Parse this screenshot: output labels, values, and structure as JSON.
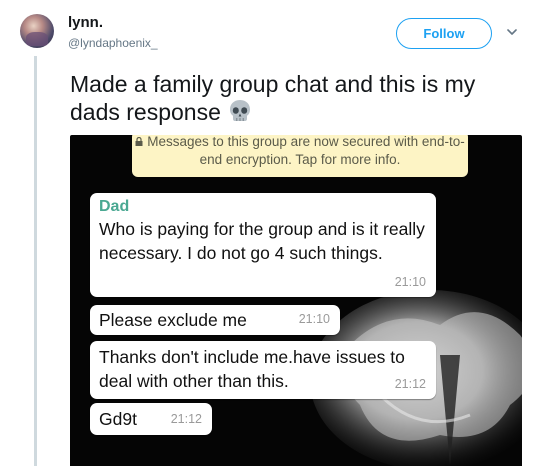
{
  "tweet": {
    "author_name": "lynn.",
    "handle": "@lyndaphoenix_",
    "follow_label": "Follow",
    "text": "Made a family group chat and this is my dads response",
    "emoji": "skull-icon"
  },
  "chat_screenshot": {
    "encryption_notice": "Messages to this group are now secured with end-to-end encryption. Tap for more info.",
    "messages": [
      {
        "sender": "Dad",
        "text": "Who is paying for the  group and is it really  necessary. I do not go 4 such things.",
        "time": "21:10"
      },
      {
        "sender": "",
        "text": "Please  exclude  me",
        "time": "21:10"
      },
      {
        "sender": "",
        "text": "Thanks  don't  include me.have issues to deal  with other  than  this.",
        "time": "21:12"
      },
      {
        "sender": "",
        "text": "Gd9t",
        "time": "21:12"
      }
    ]
  },
  "colors": {
    "follow_accent": "#1da1f2",
    "sender_name": "#4aa892",
    "encryption_banner": "#fdf4c5"
  }
}
